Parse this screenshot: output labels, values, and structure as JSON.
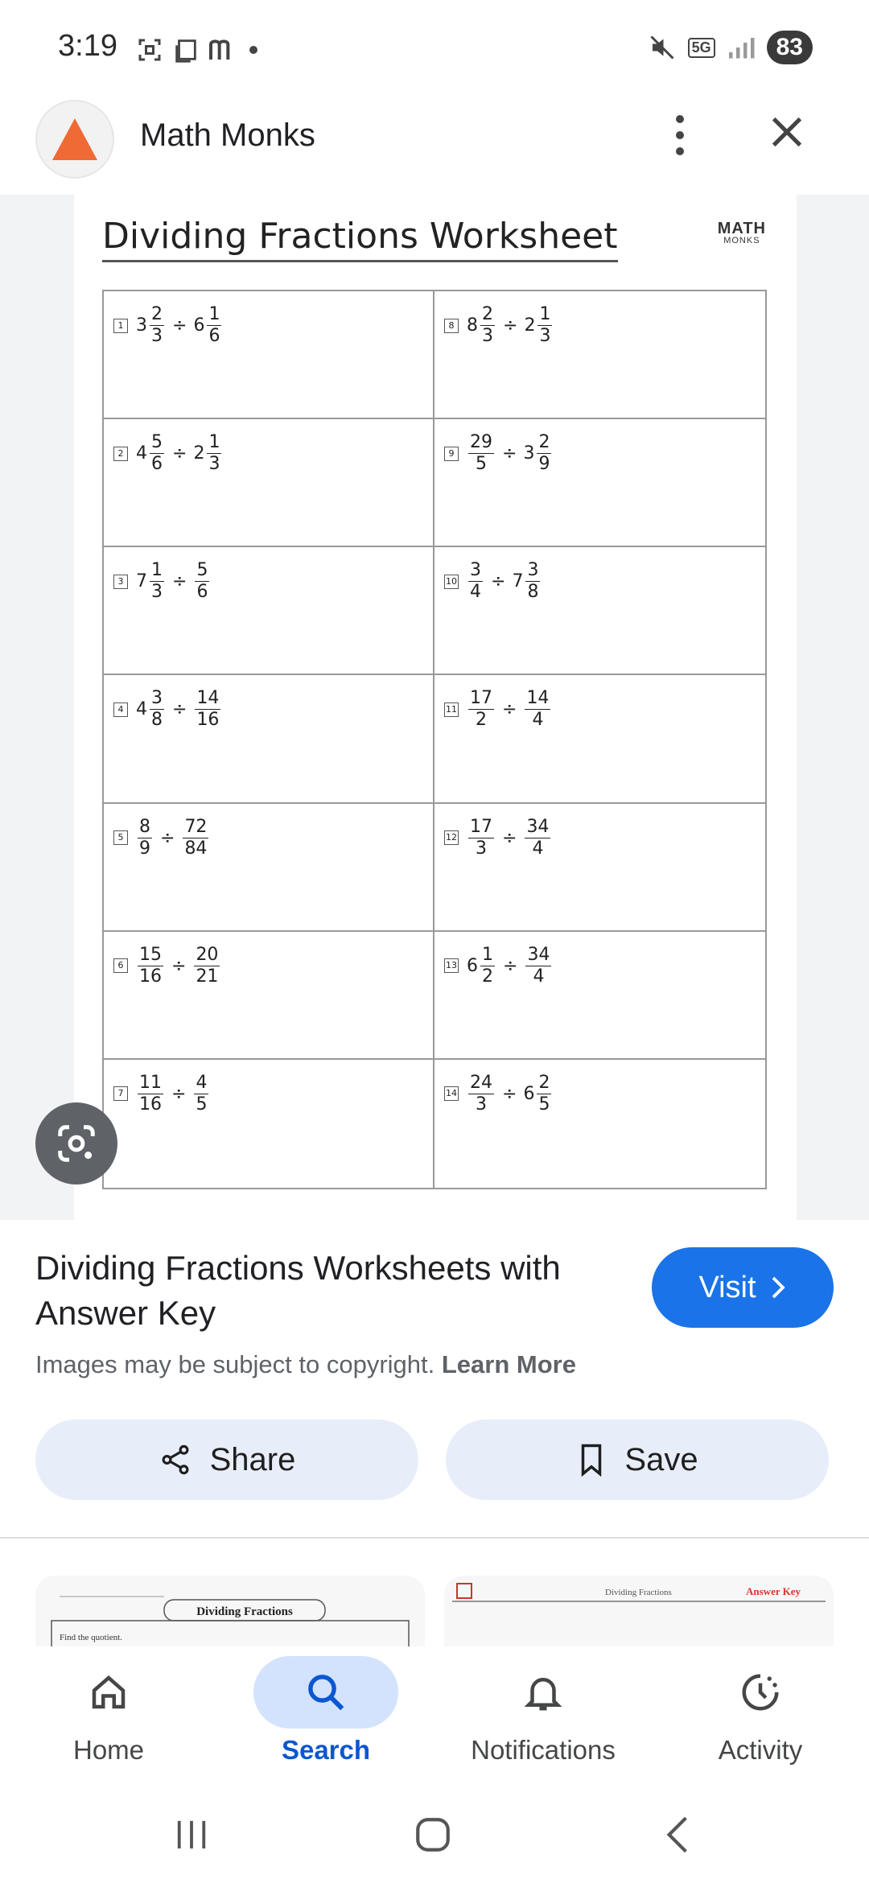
{
  "status_bar": {
    "time": "3:19",
    "battery": "83",
    "network": "5G"
  },
  "header": {
    "site_name": "Math Monks"
  },
  "worksheet": {
    "title": "Dividing Fractions Worksheet",
    "brand_line1": "MATH",
    "brand_line2": "MONKS",
    "problems": [
      {
        "num": "1",
        "parts": [
          {
            "w": "3",
            "n": "2",
            "d": "3"
          },
          {
            "w": "6",
            "n": "1",
            "d": "6"
          }
        ]
      },
      {
        "num": "8",
        "parts": [
          {
            "w": "8",
            "n": "2",
            "d": "3"
          },
          {
            "w": "2",
            "n": "1",
            "d": "3"
          }
        ]
      },
      {
        "num": "2",
        "parts": [
          {
            "w": "4",
            "n": "5",
            "d": "6"
          },
          {
            "w": "2",
            "n": "1",
            "d": "3"
          }
        ]
      },
      {
        "num": "9",
        "parts": [
          {
            "w": "",
            "n": "29",
            "d": "5"
          },
          {
            "w": "3",
            "n": "2",
            "d": "9"
          }
        ]
      },
      {
        "num": "3",
        "parts": [
          {
            "w": "7",
            "n": "1",
            "d": "3"
          },
          {
            "w": "",
            "n": "5",
            "d": "6"
          }
        ]
      },
      {
        "num": "10",
        "parts": [
          {
            "w": "",
            "n": "3",
            "d": "4"
          },
          {
            "w": "7",
            "n": "3",
            "d": "8"
          }
        ]
      },
      {
        "num": "4",
        "parts": [
          {
            "w": "4",
            "n": "3",
            "d": "8"
          },
          {
            "w": "",
            "n": "14",
            "d": "16"
          }
        ]
      },
      {
        "num": "11",
        "parts": [
          {
            "w": "",
            "n": "17",
            "d": "2"
          },
          {
            "w": "",
            "n": "14",
            "d": "4"
          }
        ]
      },
      {
        "num": "5",
        "parts": [
          {
            "w": "",
            "n": "8",
            "d": "9"
          },
          {
            "w": "",
            "n": "72",
            "d": "84"
          }
        ]
      },
      {
        "num": "12",
        "parts": [
          {
            "w": "",
            "n": "17",
            "d": "3"
          },
          {
            "w": "",
            "n": "34",
            "d": "4"
          }
        ]
      },
      {
        "num": "6",
        "parts": [
          {
            "w": "",
            "n": "15",
            "d": "16"
          },
          {
            "w": "",
            "n": "20",
            "d": "21"
          }
        ]
      },
      {
        "num": "13",
        "parts": [
          {
            "w": "6",
            "n": "1",
            "d": "2"
          },
          {
            "w": "",
            "n": "34",
            "d": "4"
          }
        ]
      },
      {
        "num": "7",
        "parts": [
          {
            "w": "",
            "n": "11",
            "d": "16"
          },
          {
            "w": "",
            "n": "4",
            "d": "5"
          }
        ]
      },
      {
        "num": "14",
        "parts": [
          {
            "w": "",
            "n": "24",
            "d": "3"
          },
          {
            "w": "6",
            "n": "2",
            "d": "5"
          }
        ]
      }
    ],
    "operator": "÷"
  },
  "result": {
    "title": "Dividing Fractions Worksheets with Answer Key",
    "visit_label": "Visit",
    "copyright_text": "Images may be subject to copyright.",
    "learn_more": "Learn More"
  },
  "actions": {
    "share_label": "Share",
    "save_label": "Save"
  },
  "thumbnails": [
    {
      "label": "Dividing Fractions",
      "sub": "Find the quotient."
    },
    {
      "label": "Dividing Fractions",
      "sub": "Answer Key"
    }
  ],
  "bottom_nav": {
    "items": [
      {
        "label": "Home",
        "icon": "home-icon"
      },
      {
        "label": "Search",
        "icon": "search-icon"
      },
      {
        "label": "Notifications",
        "icon": "bell-icon"
      },
      {
        "label": "Activity",
        "icon": "activity-icon"
      }
    ],
    "active": "Search"
  },
  "colors": {
    "accent": "#1a73e8",
    "logo": "#ef6a34",
    "chip_bg": "#e8eef9",
    "nav_active_bg": "#d3e3fd"
  }
}
